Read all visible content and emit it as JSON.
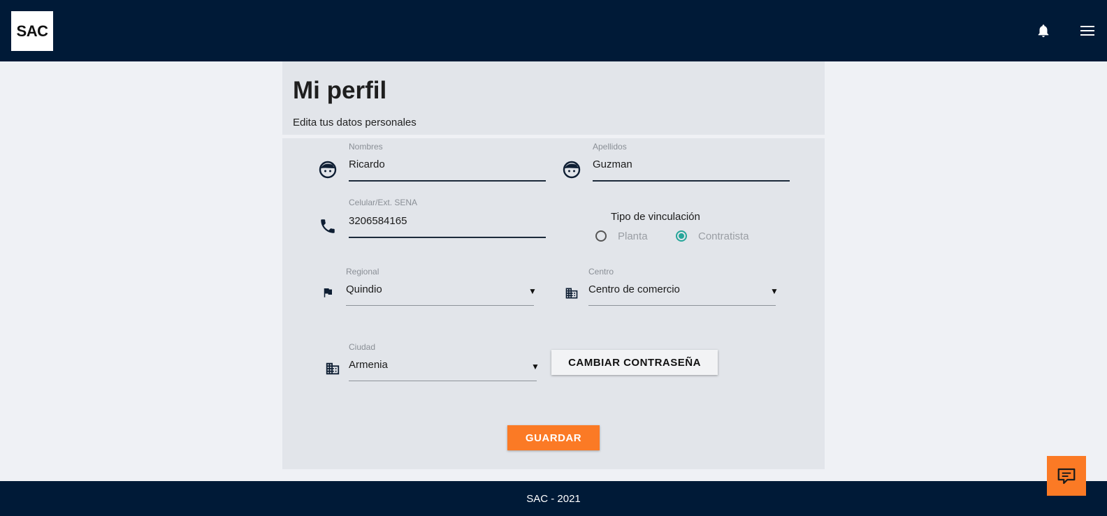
{
  "header": {
    "logo_text": "SAC",
    "bell_icon": "bell-icon",
    "menu_icon": "menu-icon"
  },
  "page": {
    "title": "Mi perfil",
    "subtitle": "Edita tus datos personales"
  },
  "form": {
    "nombres": {
      "label": "Nombres",
      "value": "Ricardo",
      "icon": "face-icon"
    },
    "apellidos": {
      "label": "Apellidos",
      "value": "Guzman",
      "icon": "face-icon"
    },
    "celular": {
      "label": "Celular/Ext. SENA",
      "value": "3206584165",
      "icon": "phone-icon"
    },
    "tipo_vinculacion": {
      "label": "Tipo de vinculación",
      "options": [
        "Planta",
        "Contratista"
      ],
      "selected": "Contratista"
    },
    "regional": {
      "label": "Regional",
      "value": "Quindio",
      "icon": "flag-icon"
    },
    "centro": {
      "label": "Centro",
      "value": "Centro de comercio",
      "icon": "building-icon"
    },
    "ciudad": {
      "label": "Ciudad",
      "value": "Armenia",
      "icon": "building-icon"
    },
    "caret": "▼"
  },
  "buttons": {
    "change_password": "CAMBIAR CONTRASEÑA",
    "save": "GUARDAR"
  },
  "footer": {
    "text": "SAC - 2021"
  },
  "colors": {
    "navy": "#001a37",
    "accent_orange": "#fb7a25",
    "radio_teal": "#26a69a",
    "card_bg": "#e2e5ea"
  },
  "chat_icon": "chat-icon"
}
